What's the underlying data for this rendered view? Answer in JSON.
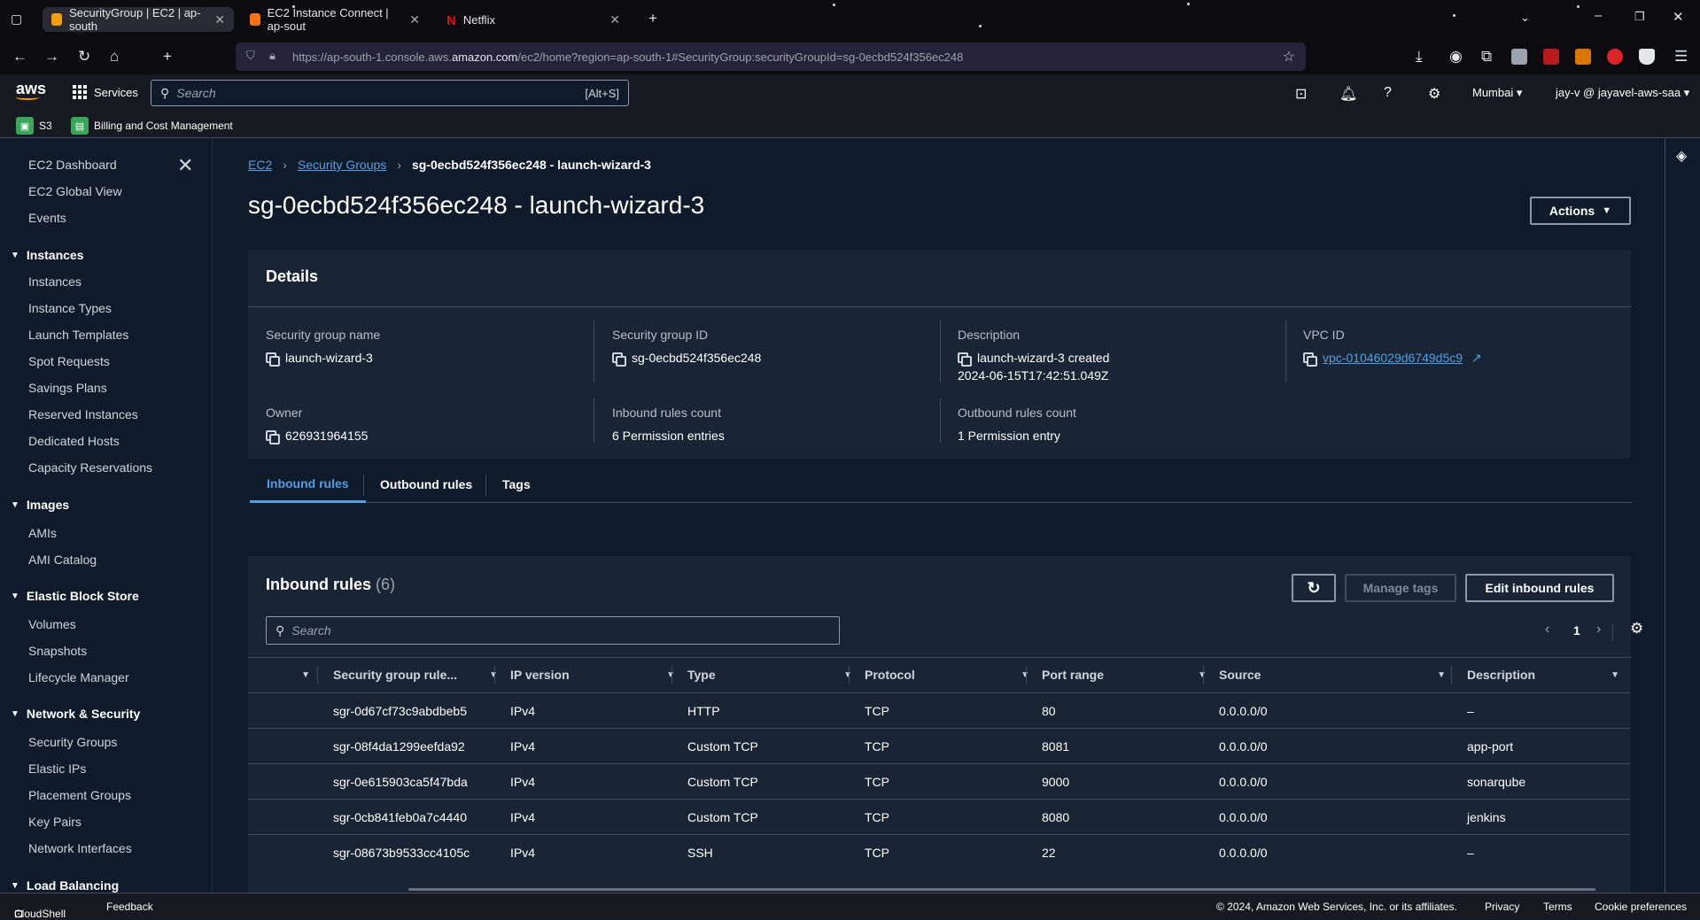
{
  "browser": {
    "tabs": [
      {
        "title": "SecurityGroup | EC2 | ap-south",
        "active": true
      },
      {
        "title": "EC2 Instance Connect | ap-sout",
        "active": false
      },
      {
        "title": "Netflix",
        "active": false
      }
    ],
    "url_prefix": "https://ap-south-1.console.aws.",
    "url_domain": "amazon.com",
    "url_path": "/ec2/home?region=ap-south-1#SecurityGroup:securityGroupId=sg-0ecbd524f356ec248"
  },
  "aws_nav": {
    "logo": "aws",
    "services_label": "Services",
    "search_placeholder": "Search",
    "search_shortcut": "[Alt+S]",
    "region": "Mumbai",
    "account": "jay-v @ jayavel-aws-saa"
  },
  "favorites": [
    {
      "label": "S3",
      "icon": "s3-icon"
    },
    {
      "label": "Billing and Cost Management",
      "icon": "billing-icon"
    }
  ],
  "sidebar": {
    "top_items": [
      "EC2 Dashboard",
      "EC2 Global View",
      "Events"
    ],
    "sections": [
      {
        "title": "Instances",
        "items": [
          "Instances",
          "Instance Types",
          "Launch Templates",
          "Spot Requests",
          "Savings Plans",
          "Reserved Instances",
          "Dedicated Hosts",
          "Capacity Reservations"
        ]
      },
      {
        "title": "Images",
        "items": [
          "AMIs",
          "AMI Catalog"
        ]
      },
      {
        "title": "Elastic Block Store",
        "items": [
          "Volumes",
          "Snapshots",
          "Lifecycle Manager"
        ]
      },
      {
        "title": "Network & Security",
        "items": [
          "Security Groups",
          "Elastic IPs",
          "Placement Groups",
          "Key Pairs",
          "Network Interfaces"
        ]
      },
      {
        "title": "Load Balancing",
        "items": []
      }
    ]
  },
  "breadcrumb": {
    "ec2": "EC2",
    "security_groups": "Security Groups",
    "current": "sg-0ecbd524f356ec248 - launch-wizard-3"
  },
  "page_title": "sg-0ecbd524f356ec248 - launch-wizard-3",
  "actions_label": "Actions",
  "details": {
    "title": "Details",
    "sg_name_label": "Security group name",
    "sg_name": "launch-wizard-3",
    "sg_id_label": "Security group ID",
    "sg_id": "sg-0ecbd524f356ec248",
    "description_label": "Description",
    "description_line1": "launch-wizard-3 created",
    "description_line2": "2024-06-15T17:42:51.049Z",
    "vpc_label": "VPC ID",
    "vpc_id": "vpc-01046029d6749d5c9",
    "owner_label": "Owner",
    "owner": "626931964155",
    "inbound_count_label": "Inbound rules count",
    "inbound_count": "6 Permission entries",
    "outbound_count_label": "Outbound rules count",
    "outbound_count": "1 Permission entry"
  },
  "tabs": [
    "Inbound rules",
    "Outbound rules",
    "Tags"
  ],
  "inbound": {
    "title": "Inbound rules",
    "count": "(6)",
    "manage_tags": "Manage tags",
    "edit_rules": "Edit inbound rules",
    "search_placeholder": "Search",
    "page": "1",
    "columns": [
      "Security group rule...",
      "IP version",
      "Type",
      "Protocol",
      "Port range",
      "Source",
      "Description"
    ],
    "rows": [
      [
        "sgr-0d67cf73c9abdbeb5",
        "IPv4",
        "HTTP",
        "TCP",
        "80",
        "0.0.0.0/0",
        "–"
      ],
      [
        "sgr-08f4da1299eefda92",
        "IPv4",
        "Custom TCP",
        "TCP",
        "8081",
        "0.0.0.0/0",
        "app-port"
      ],
      [
        "sgr-0e615903ca5f47bda",
        "IPv4",
        "Custom TCP",
        "TCP",
        "9000",
        "0.0.0.0/0",
        "sonarqube"
      ],
      [
        "sgr-0cb841feb0a7c4440",
        "IPv4",
        "Custom TCP",
        "TCP",
        "8080",
        "0.0.0.0/0",
        "jenkins"
      ],
      [
        "sgr-08673b9533cc4105c",
        "IPv4",
        "SSH",
        "TCP",
        "22",
        "0.0.0.0/0",
        "–"
      ]
    ]
  },
  "footer": {
    "cloudshell": "CloudShell",
    "feedback": "Feedback",
    "copyright": "© 2024, Amazon Web Services, Inc. or its affiliates.",
    "privacy": "Privacy",
    "terms": "Terms",
    "cookies": "Cookie preferences"
  }
}
